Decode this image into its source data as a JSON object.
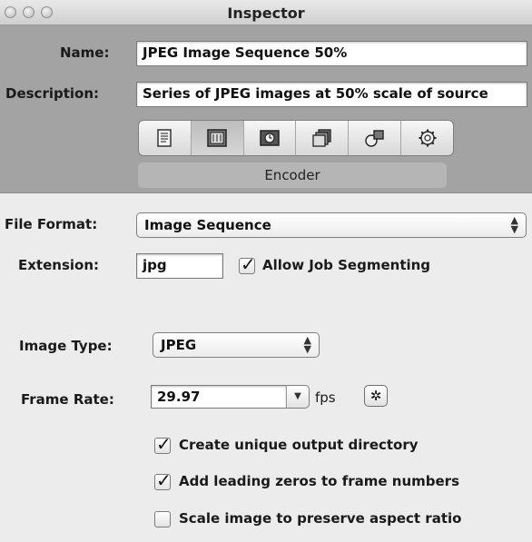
{
  "window": {
    "title": "Inspector"
  },
  "top": {
    "name_label": "Name:",
    "name_value": "JPEG Image Sequence 50%",
    "description_label": "Description:",
    "description_value": "Series of JPEG images at 50% scale of source",
    "tabs": [
      {
        "icon": "summary-icon"
      },
      {
        "icon": "encoder-icon"
      },
      {
        "icon": "frame-controls-icon"
      },
      {
        "icon": "filters-icon"
      },
      {
        "icon": "geometry-icon"
      },
      {
        "icon": "actions-icon"
      }
    ],
    "active_tab_label": "Encoder"
  },
  "encoder": {
    "file_format_label": "File Format:",
    "file_format_value": "Image Sequence",
    "extension_label": "Extension:",
    "extension_value": "jpg",
    "allow_job_segmenting_label": "Allow Job Segmenting",
    "allow_job_segmenting_checked": true,
    "image_type_label": "Image Type:",
    "image_type_value": "JPEG",
    "frame_rate_label": "Frame Rate:",
    "frame_rate_value": "29.97",
    "fps_label": "fps",
    "options": [
      {
        "label": "Create unique output directory",
        "checked": true
      },
      {
        "label": "Add leading zeros to frame numbers",
        "checked": true
      },
      {
        "label": "Scale image to preserve aspect ratio",
        "checked": false
      }
    ]
  },
  "glyphs": {
    "check": "✓",
    "popup_arrows": "▲▼",
    "combo_arrow": "▼",
    "gear": "✲"
  }
}
